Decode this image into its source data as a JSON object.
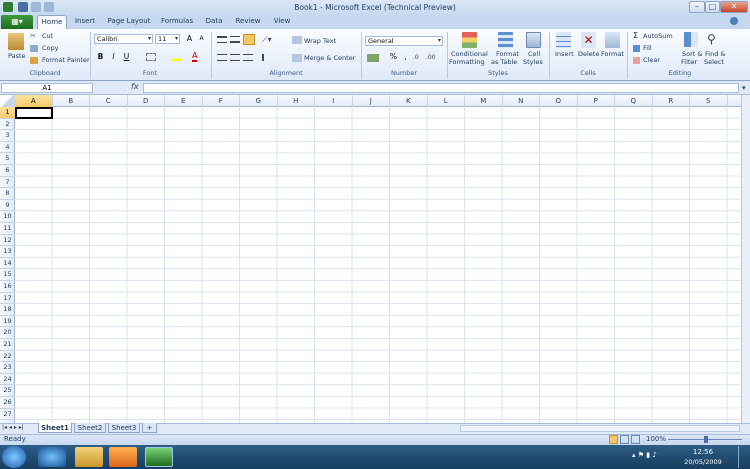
{
  "window": {
    "title": "Book1 - Microsoft Excel (Technical Preview)"
  },
  "ribbon_tabs": {
    "file": "",
    "home": "Home",
    "insert": "Insert",
    "page_layout": "Page Layout",
    "formulas": "Formulas",
    "data": "Data",
    "review": "Review",
    "view": "View"
  },
  "clipboard": {
    "paste": "Paste",
    "cut": "Cut",
    "copy": "Copy",
    "format_painter": "Format Painter",
    "group": "Clipboard"
  },
  "font": {
    "name": "Calibri",
    "size": "11",
    "bold": "B",
    "italic": "I",
    "underline": "U",
    "grow": "A",
    "shrink": "A",
    "group": "Font"
  },
  "alignment": {
    "wrap": "Wrap Text",
    "merge": "Merge & Center",
    "group": "Alignment"
  },
  "number": {
    "format": "General",
    "percent": "%",
    "comma": ",",
    "group": "Number"
  },
  "styles": {
    "conditional": "Conditional",
    "conditional2": "Formatting",
    "format_table": "Format",
    "format_table2": "as Table",
    "cell_styles": "Cell",
    "cell_styles2": "Styles",
    "group": "Styles"
  },
  "cells": {
    "insert": "Insert",
    "delete": "Delete",
    "format": "Format",
    "group": "Cells"
  },
  "editing": {
    "autosum": "AutoSum",
    "fill": "Fill",
    "clear": "Clear",
    "sort": "Sort &",
    "sort2": "Filter",
    "find": "Find &",
    "find2": "Select",
    "group": "Editing"
  },
  "formula_bar": {
    "name_box": "A1",
    "fx": "fx",
    "value": ""
  },
  "columns": [
    "A",
    "B",
    "C",
    "D",
    "E",
    "F",
    "G",
    "H",
    "I",
    "J",
    "K",
    "L",
    "M",
    "N",
    "O",
    "P",
    "Q",
    "R",
    "S"
  ],
  "rows": [
    "1",
    "2",
    "3",
    "4",
    "5",
    "6",
    "7",
    "8",
    "9",
    "10",
    "11",
    "12",
    "13",
    "14",
    "15",
    "16",
    "17",
    "18",
    "19",
    "20",
    "21",
    "22",
    "23",
    "24",
    "25",
    "26",
    "27"
  ],
  "sheets": [
    "Sheet1",
    "Sheet2",
    "Sheet3"
  ],
  "status": {
    "ready": "Ready",
    "zoom": "100%"
  },
  "clock": {
    "time": "12:56",
    "date": "20/05/2009"
  },
  "colors": {
    "accent": "#f6c768",
    "ribbon": "#dfe9f7",
    "file_tab": "#1c6d1c"
  }
}
